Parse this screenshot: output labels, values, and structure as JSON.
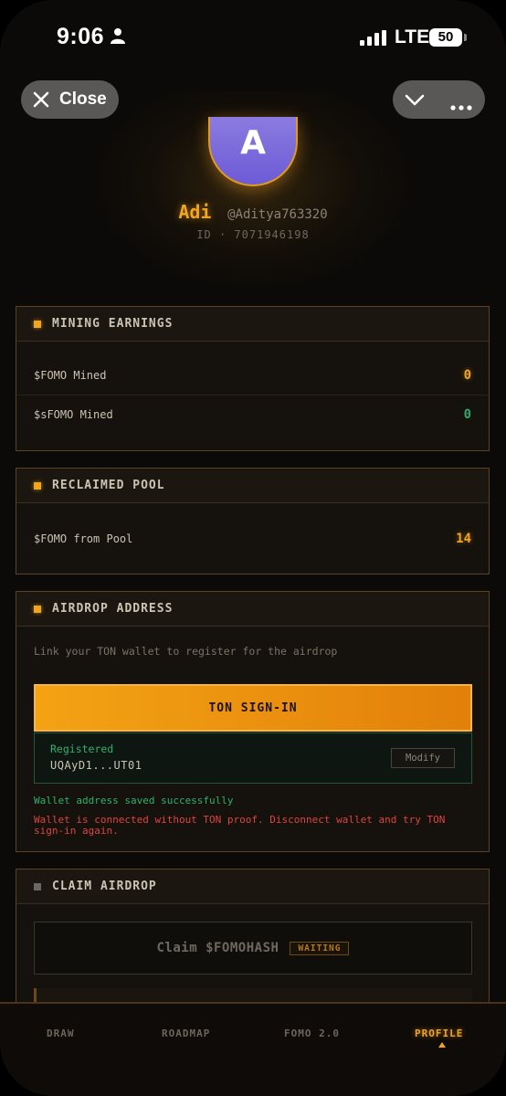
{
  "status_bar": {
    "time": "9:06",
    "network": "LTE",
    "battery": "50"
  },
  "top_controls": {
    "close_label": "Close"
  },
  "profile": {
    "avatar_initial": "A",
    "display_name": "Adi",
    "username": "@Aditya763320",
    "user_id": "ID · 7071946198"
  },
  "mining_earnings": {
    "title": "MINING EARNINGS",
    "rows": [
      {
        "label": "$FOMO Mined",
        "value": "0"
      },
      {
        "label": "$sFOMO Mined",
        "value": "0"
      }
    ]
  },
  "reclaimed_pool": {
    "title": "RECLAIMED POOL",
    "rows": [
      {
        "label": "$FOMO from Pool",
        "value": "14"
      }
    ]
  },
  "airdrop_address": {
    "title": "AIRDROP ADDRESS",
    "description": "Link your TON wallet to register for the airdrop",
    "sign_in_label": "TON SIGN-IN",
    "registered_label": "Registered",
    "wallet_address": "UQAyD1...UT01",
    "modify_label": "Modify",
    "success_message": "Wallet address saved successfully",
    "error_message": "Wallet is connected without TON proof. Disconnect wallet and try TON sign-in again."
  },
  "claim_airdrop": {
    "title": "CLAIM AIRDROP",
    "claim_label": "Claim $FOMOHASH",
    "status_badge": "WAITING"
  },
  "bottom_nav": {
    "items": [
      {
        "label": "DRAW"
      },
      {
        "label": "ROADMAP"
      },
      {
        "label": "FOMO 2.0"
      },
      {
        "label": "PROFILE"
      }
    ],
    "active": "PROFILE"
  },
  "colors": {
    "accent": "#f2a51c",
    "success": "#2fb06f",
    "error": "#e0443e",
    "background": "#0c0a08"
  }
}
